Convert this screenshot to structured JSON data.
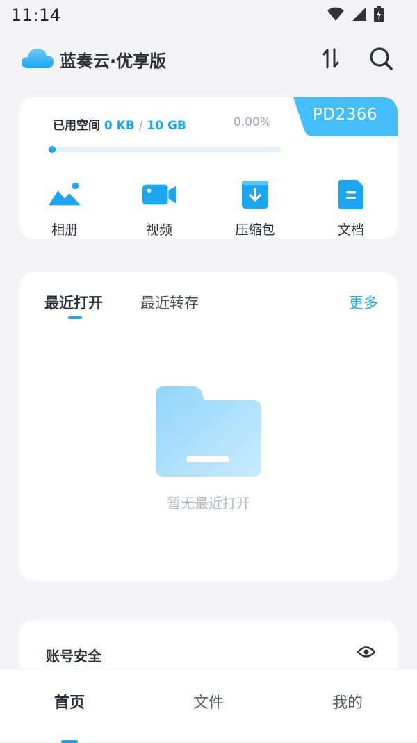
{
  "status_bar": {
    "time": "11:14",
    "icons": [
      "wifi-icon",
      "signal-icon",
      "battery-icon"
    ]
  },
  "app_bar": {
    "title": "蓝奏云·优享版",
    "logo_icon": "cloud-logo-icon",
    "actions": [
      "transfer-icon",
      "search-icon"
    ]
  },
  "storage": {
    "label": "已用空间",
    "used": "0 KB",
    "separator": "/",
    "total": "10 GB",
    "percent": "0.00%",
    "progress_fraction": 0.0,
    "plan_badge": "PD2366"
  },
  "categories": [
    {
      "label": "相册",
      "icon": "photo-icon"
    },
    {
      "label": "视频",
      "icon": "video-icon"
    },
    {
      "label": "压缩包",
      "icon": "archive-icon"
    },
    {
      "label": "文档",
      "icon": "document-icon"
    }
  ],
  "recent": {
    "tabs": [
      {
        "label": "最近打开",
        "active": true
      },
      {
        "label": "最近转存",
        "active": false
      }
    ],
    "more": "更多",
    "empty_text": "暂无最近打开"
  },
  "security": {
    "title": "账号安全",
    "icon": "eye-icon"
  },
  "bottom_nav": [
    {
      "label": "首页",
      "active": true
    },
    {
      "label": "文件",
      "active": false
    },
    {
      "label": "我的",
      "active": false
    }
  ],
  "colors": {
    "accent": "#1aa6f0",
    "background": "#f4f4f6",
    "card": "#ffffff",
    "text": "#2b2f36",
    "muted": "#b7bbc2"
  }
}
